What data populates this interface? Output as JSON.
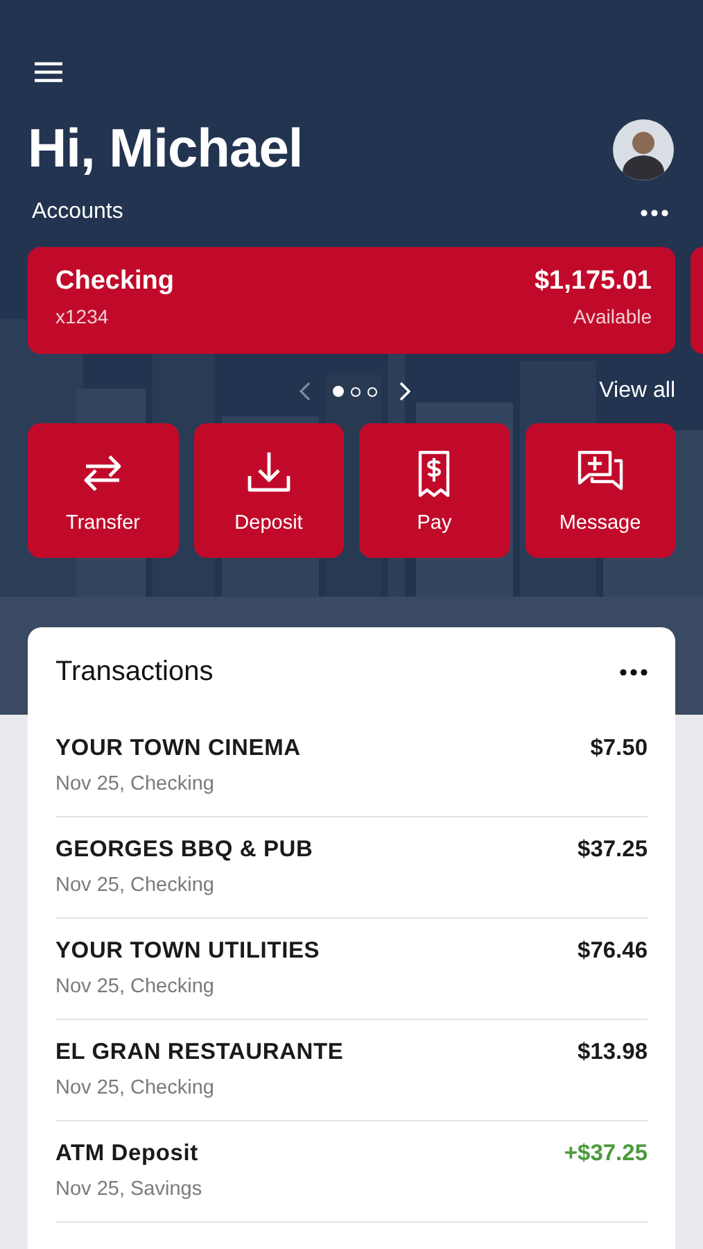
{
  "greeting": "Hi, Michael",
  "accounts": {
    "title": "Accounts",
    "cards": [
      {
        "name": "Checking",
        "number": "x1234",
        "balance": "$1,175.01",
        "balance_label": "Available"
      }
    ],
    "pager": [
      {
        "selected": true
      },
      {
        "selected": false
      },
      {
        "selected": false
      }
    ],
    "view_all": "View all"
  },
  "actions": [
    {
      "kind": "transfer",
      "label": "Transfer"
    },
    {
      "kind": "deposit",
      "label": "Deposit"
    },
    {
      "kind": "pay",
      "label": "Pay"
    },
    {
      "kind": "message",
      "label": "Message"
    }
  ],
  "transactions": {
    "title": "Transactions",
    "rows": [
      {
        "merchant": "YOUR TOWN CINEMA",
        "detail": "Nov 25, Checking",
        "amount": "$7.50",
        "kind": "debit"
      },
      {
        "merchant": "GEORGES BBQ & PUB",
        "detail": "Nov 25, Checking",
        "amount": "$37.25",
        "kind": "debit"
      },
      {
        "merchant": "YOUR TOWN UTILITIES",
        "detail": "Nov 25, Checking",
        "amount": "$76.46",
        "kind": "debit"
      },
      {
        "merchant": "EL GRAN RESTAURANTE",
        "detail": "Nov 25, Checking",
        "amount": "$13.98",
        "kind": "debit"
      },
      {
        "merchant": "ATM Deposit",
        "detail": "Nov 25, Savings",
        "amount": "+$37.25",
        "kind": "credit"
      }
    ]
  }
}
